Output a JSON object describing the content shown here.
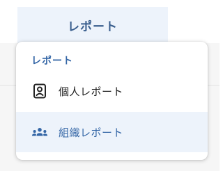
{
  "nav": {
    "report_tab_label": "レポート"
  },
  "dropdown": {
    "header": "レポート",
    "items": [
      {
        "label": "個人レポート",
        "icon": "person-card-icon"
      },
      {
        "label": "組織レポート",
        "icon": "group-icon"
      }
    ]
  },
  "colors": {
    "accent": "#3466a6",
    "tab_background": "#edf3fb",
    "hover_background": "#edf3fb",
    "text": "#222222"
  }
}
